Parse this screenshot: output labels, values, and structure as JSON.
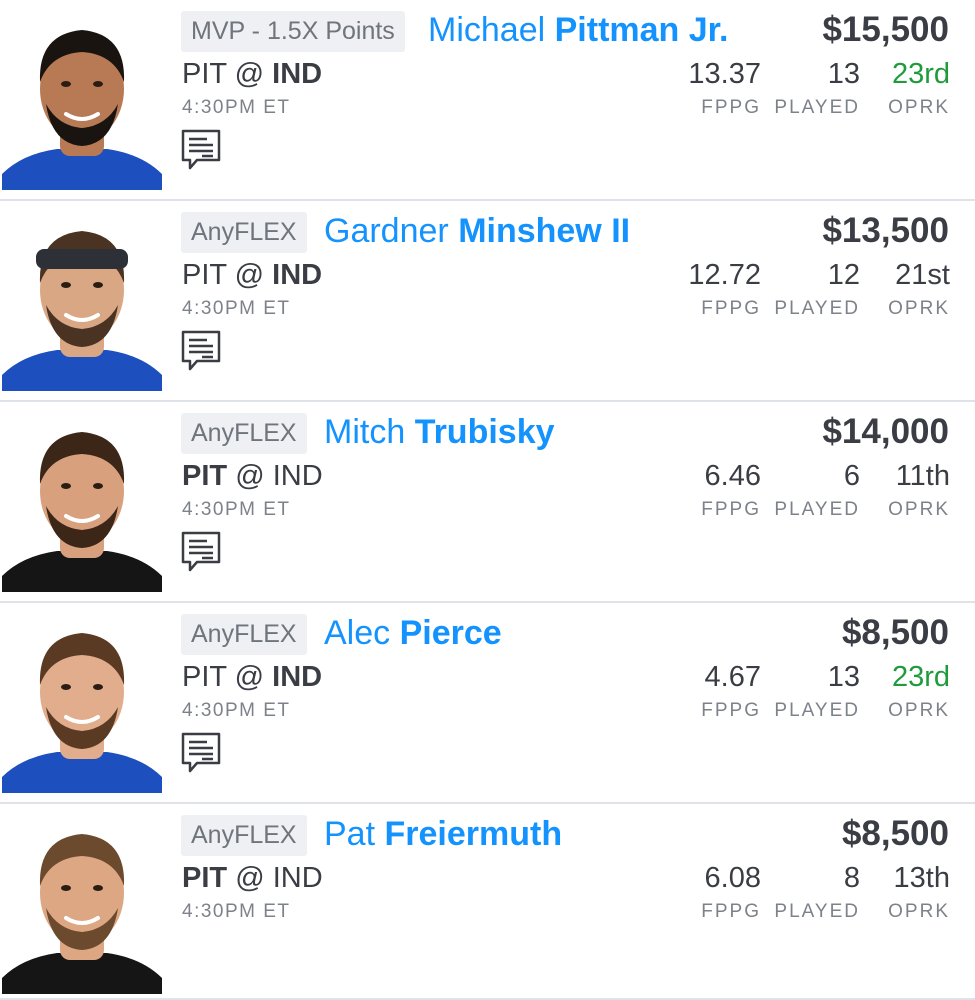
{
  "players": [
    {
      "position_label": "MVP - 1.5X Points",
      "first_name": "Michael",
      "last_name": "Pittman Jr.",
      "salary": "$15,500",
      "away_team": "PIT",
      "at": "@",
      "home_team": "IND",
      "highlight_team": "home",
      "game_time": "4:30PM ET",
      "has_news": true,
      "fppg": "13.37",
      "fppg_label": "FPPG",
      "played": "13",
      "played_label": "PLAYED",
      "oprk": "23rd",
      "oprk_label": "OPRK",
      "oprk_good": true,
      "jersey_color": "#1d4fbf",
      "skin_color": "#b77a55",
      "hair_color": "#1a1410",
      "has_headband": false
    },
    {
      "position_label": "AnyFLEX",
      "first_name": "Gardner",
      "last_name": "Minshew II",
      "salary": "$13,500",
      "away_team": "PIT",
      "at": "@",
      "home_team": "IND",
      "highlight_team": "home",
      "game_time": "4:30PM ET",
      "has_news": true,
      "fppg": "12.72",
      "fppg_label": "FPPG",
      "played": "12",
      "played_label": "PLAYED",
      "oprk": "21st",
      "oprk_label": "OPRK",
      "oprk_good": false,
      "jersey_color": "#1d4fbf",
      "skin_color": "#d9a784",
      "hair_color": "#4a3322",
      "has_headband": true
    },
    {
      "position_label": "AnyFLEX",
      "first_name": "Mitch",
      "last_name": "Trubisky",
      "salary": "$14,000",
      "away_team": "PIT",
      "at": "@",
      "home_team": "IND",
      "highlight_team": "away",
      "game_time": "4:30PM ET",
      "has_news": true,
      "fppg": "6.46",
      "fppg_label": "FPPG",
      "played": "6",
      "played_label": "PLAYED",
      "oprk": "11th",
      "oprk_label": "OPRK",
      "oprk_good": false,
      "jersey_color": "#151515",
      "skin_color": "#d9a07e",
      "hair_color": "#3b2618",
      "has_headband": false
    },
    {
      "position_label": "AnyFLEX",
      "first_name": "Alec",
      "last_name": "Pierce",
      "salary": "$8,500",
      "away_team": "PIT",
      "at": "@",
      "home_team": "IND",
      "highlight_team": "home",
      "game_time": "4:30PM ET",
      "has_news": true,
      "fppg": "4.67",
      "fppg_label": "FPPG",
      "played": "13",
      "played_label": "PLAYED",
      "oprk": "23rd",
      "oprk_label": "OPRK",
      "oprk_good": true,
      "jersey_color": "#1d4fbf",
      "skin_color": "#e2ad8c",
      "hair_color": "#5a3a22",
      "has_headband": false
    },
    {
      "position_label": "AnyFLEX",
      "first_name": "Pat",
      "last_name": "Freiermuth",
      "salary": "$8,500",
      "away_team": "PIT",
      "at": "@",
      "home_team": "IND",
      "highlight_team": "away",
      "game_time": "4:30PM ET",
      "has_news": false,
      "fppg": "6.08",
      "fppg_label": "FPPG",
      "played": "8",
      "played_label": "PLAYED",
      "oprk": "13th",
      "oprk_label": "OPRK",
      "oprk_good": false,
      "jersey_color": "#151515",
      "skin_color": "#dea784",
      "hair_color": "#6b4a2e",
      "has_headband": false
    }
  ]
}
